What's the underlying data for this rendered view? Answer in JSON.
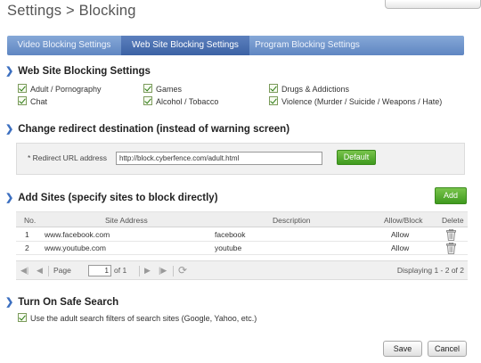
{
  "header": {
    "title": "Settings > Blocking"
  },
  "tabs": [
    {
      "label": "Video Blocking Settings",
      "active": false
    },
    {
      "label": "Web Site Blocking Settings",
      "active": true
    },
    {
      "label": "Program Blocking Settings",
      "active": false
    }
  ],
  "web_site_blocking": {
    "heading": "Web Site Blocking Settings",
    "categories": [
      {
        "label": "Adult / Pornography",
        "checked": true
      },
      {
        "label": "Games",
        "checked": true
      },
      {
        "label": "Drugs & Addictions",
        "checked": true
      },
      {
        "label": "Chat",
        "checked": true
      },
      {
        "label": "Alcohol / Tobacco",
        "checked": true
      },
      {
        "label": "Violence (Murder / Suicide / Weapons / Hate)",
        "checked": true
      }
    ]
  },
  "redirect": {
    "heading": "Change redirect destination (instead of warning screen)",
    "label": "* Redirect URL address",
    "url_value": "http://block.cyberfence.com/adult.html",
    "default_button": "Default"
  },
  "add_sites": {
    "heading": "Add Sites (specify sites to block directly)",
    "add_button": "Add",
    "columns": {
      "no": "No.",
      "address": "Site Address",
      "description": "Description",
      "allow_block": "Allow/Block",
      "delete": "Delete"
    },
    "rows": [
      {
        "no": "1",
        "address": "www.facebook.com",
        "description": "facebook",
        "allow_block": "Allow"
      },
      {
        "no": "2",
        "address": "www.youtube.com",
        "description": "youtube",
        "allow_block": "Allow"
      }
    ],
    "pager": {
      "page_label": "Page",
      "page_value": "1",
      "of_label": "of 1",
      "display_text": "Displaying 1 - 2 of 2"
    }
  },
  "safe_search": {
    "heading": "Turn On Safe Search",
    "option_label": "Use the adult search filters of search sites (Google, Yahoo, etc.)",
    "checked": true
  },
  "footer": {
    "save_button": "Save",
    "cancel_button": "Cancel"
  },
  "colors": {
    "accent_blue": "#5f86c2",
    "active_tab": "#3c62a4",
    "green_button": "#4ea62a",
    "chevron": "#3c6fc0"
  },
  "icons": [
    "chevron-right-icon",
    "checkbox-checked-icon",
    "trash-icon",
    "first-page-icon",
    "prev-page-icon",
    "next-page-icon",
    "last-page-icon",
    "refresh-icon"
  ]
}
